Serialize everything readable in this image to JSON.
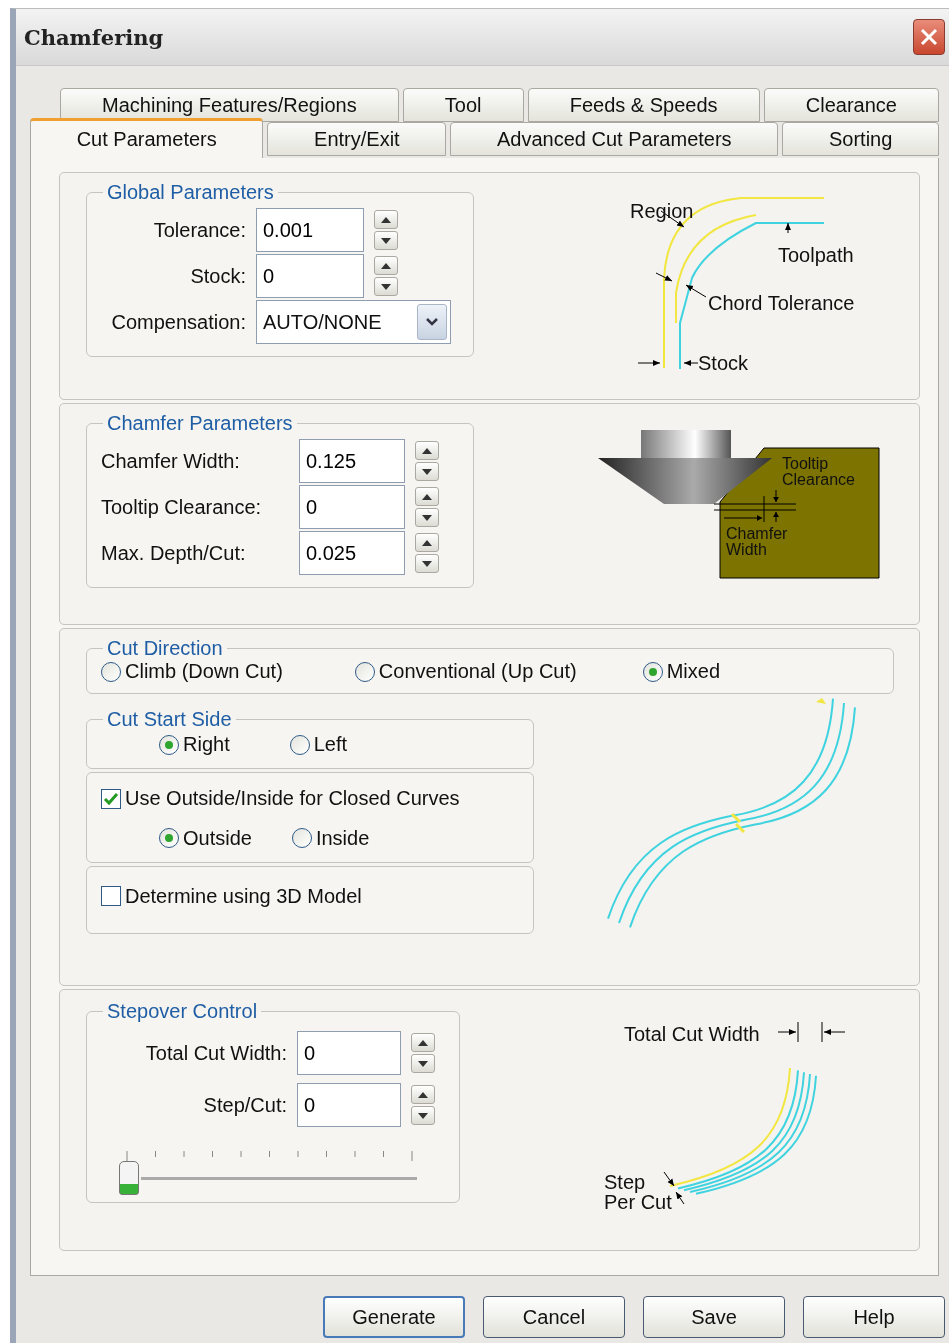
{
  "window": {
    "title": "Chamfering"
  },
  "tab_rows": [
    {
      "tabs": [
        {
          "label": "Machining Features/Regions",
          "selected": false
        },
        {
          "label": "Tool",
          "selected": false
        },
        {
          "label": "Feeds & Speeds",
          "selected": false
        },
        {
          "label": "Clearance",
          "selected": false
        }
      ]
    },
    {
      "tabs": [
        {
          "label": "Cut Parameters",
          "selected": true
        },
        {
          "label": "Entry/Exit",
          "selected": false
        },
        {
          "label": "Advanced Cut Parameters",
          "selected": false
        },
        {
          "label": "Sorting",
          "selected": false
        }
      ]
    }
  ],
  "global_parameters": {
    "title": "Global Parameters",
    "fields": [
      {
        "kind": "spinner",
        "label": "Tolerance:",
        "value": "0.001"
      },
      {
        "kind": "spinner",
        "label": "Stock:",
        "value": "0"
      },
      {
        "kind": "dropdown",
        "label": "Compensation:",
        "value": "AUTO/NONE"
      }
    ],
    "diagram_labels": [
      "Region",
      "Toolpath",
      "Chord Tolerance",
      "Stock"
    ]
  },
  "chamfer_parameters": {
    "title": "Chamfer Parameters",
    "fields": [
      {
        "kind": "spinner",
        "label": "Chamfer Width:",
        "value": "0.125"
      },
      {
        "kind": "spinner",
        "label": "Tooltip Clearance:",
        "value": "0"
      },
      {
        "kind": "spinner",
        "label": "Max. Depth/Cut:",
        "value": "0.025"
      }
    ],
    "diagram_labels": [
      "Tooltip Clearance",
      "Chamfer Width"
    ]
  },
  "cut_direction": {
    "title": "Cut Direction",
    "options": [
      {
        "label": "Climb (Down Cut)",
        "selected": false
      },
      {
        "label": "Conventional (Up Cut)",
        "selected": false
      },
      {
        "label": "Mixed",
        "selected": true
      }
    ]
  },
  "cut_start_side": {
    "title": "Cut Start Side",
    "options": [
      {
        "label": "Right",
        "selected": true
      },
      {
        "label": "Left",
        "selected": false
      }
    ],
    "closed_curves": {
      "label": "Use Outside/Inside for Closed Curves",
      "checked": true,
      "options": [
        {
          "label": "Outside",
          "selected": true
        },
        {
          "label": "Inside",
          "selected": false
        }
      ]
    },
    "model": {
      "label": "Determine using 3D Model",
      "checked": false
    }
  },
  "stepover_control": {
    "title": "Stepover Control",
    "fields": [
      {
        "kind": "spinner",
        "label": "Total Cut Width:",
        "value": "0"
      },
      {
        "kind": "spinner",
        "label": "Step/Cut:",
        "value": "0"
      }
    ],
    "slider": {
      "level": 0
    },
    "diagram_labels": [
      "Total Cut Width",
      "Step Per Cut"
    ]
  },
  "buttons": [
    {
      "label": "Generate",
      "default": true
    },
    {
      "label": "Cancel",
      "default": false
    },
    {
      "label": "Save",
      "default": false
    },
    {
      "label": "Help",
      "default": false
    }
  ]
}
